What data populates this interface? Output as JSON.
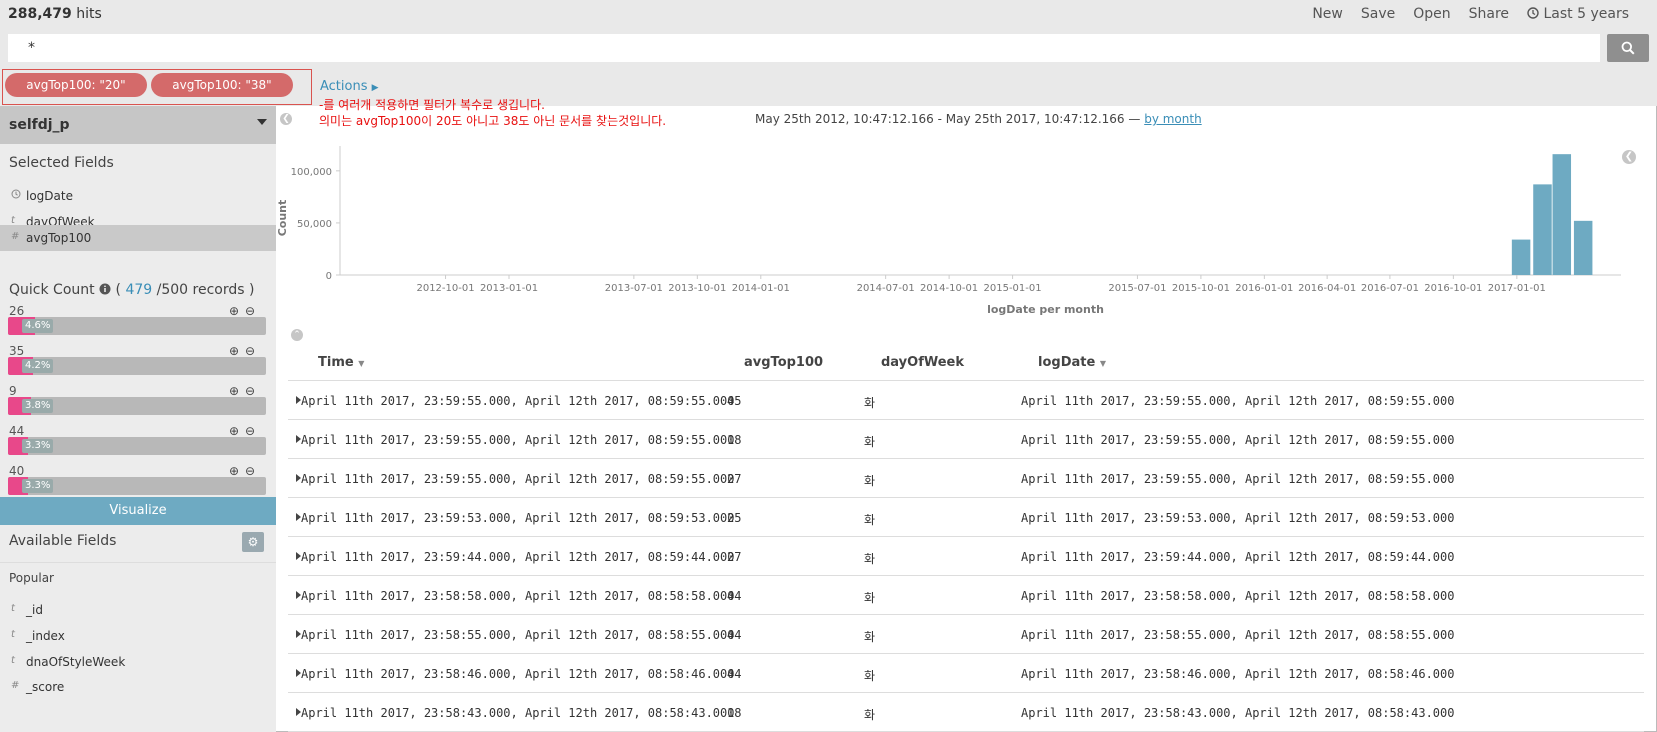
{
  "header": {
    "hits_count": "288,479",
    "hits_label": "hits",
    "nav": [
      "New",
      "Save",
      "Open",
      "Share"
    ],
    "time_picker": "Last 5 years"
  },
  "search": {
    "query": "*"
  },
  "filters": {
    "pills": [
      "avgTop100: \"20\"",
      "avgTop100: \"38\""
    ],
    "actions_label": "Actions"
  },
  "annotation": {
    "line1": "-를 여러개 적용하면 필터가 복수로 생깁니다.",
    "line2": "의미는 avgTop100이 20도 아니고 38도 아닌 문서를 찾는것입니다."
  },
  "date_range": {
    "text": "May 25th 2012, 10:47:12.166 - May 25th 2017, 10:47:12.166 —",
    "interval_link": "by month"
  },
  "sidebar": {
    "index_name": "selfdj_p",
    "selected_title": "Selected Fields",
    "selected_fields": [
      {
        "type": "clock",
        "name": "logDate"
      },
      {
        "type": "t",
        "name": "dayOfWeek"
      },
      {
        "type": "#",
        "name": "avgTop100"
      }
    ],
    "quick_count": {
      "label": "Quick Count",
      "open": "(",
      "count": "479",
      "rest": "/500 records )"
    },
    "buckets": [
      {
        "value": "26",
        "percent": "4.6%",
        "fraction": 0.046
      },
      {
        "value": "35",
        "percent": "4.2%",
        "fraction": 0.042
      },
      {
        "value": "9",
        "percent": "3.8%",
        "fraction": 0.038
      },
      {
        "value": "44",
        "percent": "3.3%",
        "fraction": 0.033
      },
      {
        "value": "40",
        "percent": "3.3%",
        "fraction": 0.033
      }
    ],
    "visualize_label": "Visualize",
    "available_title": "Available Fields",
    "popular_label": "Popular",
    "available_fields": [
      {
        "type": "t",
        "name": "_id"
      },
      {
        "type": "t",
        "name": "_index"
      },
      {
        "type": "t",
        "name": "dnaOfStyleWeek"
      },
      {
        "type": "#",
        "name": "_score"
      }
    ]
  },
  "chart_data": {
    "type": "bar",
    "title": "",
    "xlabel": "logDate per month",
    "ylabel": "Count",
    "yticks": [
      "0",
      "50,000",
      "100,000"
    ],
    "ylim": [
      0,
      120000
    ],
    "xticks": [
      "2012-10-01",
      "2013-01-01",
      "2013-07-01",
      "2013-10-01",
      "2014-01-01",
      "2014-07-01",
      "2014-10-01",
      "2015-01-01",
      "2015-07-01",
      "2015-10-01",
      "2016-01-01",
      "2016-04-01",
      "2016-07-01",
      "2016-10-01",
      "2017-01-01"
    ],
    "categories": [
      "2017-01",
      "2017-02",
      "2017-03",
      "2017-04"
    ],
    "values": [
      34000,
      87000,
      116000,
      52000
    ],
    "color": "#6eaac2",
    "grid": false
  },
  "table": {
    "columns": [
      "Time",
      "avgTop100",
      "dayOfWeek",
      "logDate"
    ],
    "rows": [
      [
        "April 11th 2017, 23:59:55.000, April 12th 2017, 08:59:55.000",
        "45",
        "화",
        "April 11th 2017, 23:59:55.000, April 12th 2017, 08:59:55.000"
      ],
      [
        "April 11th 2017, 23:59:55.000, April 12th 2017, 08:59:55.000",
        "18",
        "화",
        "April 11th 2017, 23:59:55.000, April 12th 2017, 08:59:55.000"
      ],
      [
        "April 11th 2017, 23:59:55.000, April 12th 2017, 08:59:55.000",
        "27",
        "화",
        "April 11th 2017, 23:59:55.000, April 12th 2017, 08:59:55.000"
      ],
      [
        "April 11th 2017, 23:59:53.000, April 12th 2017, 08:59:53.000",
        "25",
        "화",
        "April 11th 2017, 23:59:53.000, April 12th 2017, 08:59:53.000"
      ],
      [
        "April 11th 2017, 23:59:44.000, April 12th 2017, 08:59:44.000",
        "27",
        "화",
        "April 11th 2017, 23:59:44.000, April 12th 2017, 08:59:44.000"
      ],
      [
        "April 11th 2017, 23:58:58.000, April 12th 2017, 08:58:58.000",
        "44",
        "화",
        "April 11th 2017, 23:58:58.000, April 12th 2017, 08:58:58.000"
      ],
      [
        "April 11th 2017, 23:58:55.000, April 12th 2017, 08:58:55.000",
        "44",
        "화",
        "April 11th 2017, 23:58:55.000, April 12th 2017, 08:58:55.000"
      ],
      [
        "April 11th 2017, 23:58:46.000, April 12th 2017, 08:58:46.000",
        "44",
        "화",
        "April 11th 2017, 23:58:46.000, April 12th 2017, 08:58:46.000"
      ],
      [
        "April 11th 2017, 23:58:43.000, April 12th 2017, 08:58:43.000",
        "18",
        "화",
        "April 11th 2017, 23:58:43.000, April 12th 2017, 08:58:43.000"
      ]
    ]
  }
}
